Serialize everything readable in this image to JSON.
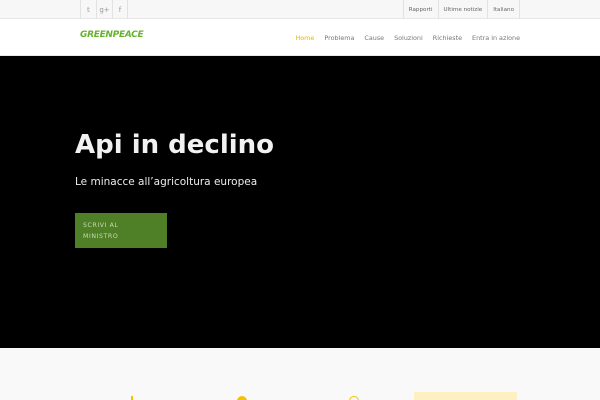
{
  "topbar": {
    "social": [
      {
        "icon": "twitter-icon",
        "glyph": "𝕥"
      },
      {
        "icon": "google-plus-icon",
        "glyph": "g+"
      },
      {
        "icon": "facebook-icon",
        "glyph": "f"
      }
    ],
    "links": [
      "Rapporti",
      "Ultime notizie",
      "Italiano"
    ]
  },
  "header": {
    "logo": "GREENPEACE",
    "nav": [
      "Home",
      "Problema",
      "Cause",
      "Soluzioni",
      "Richieste",
      "Entra in azione"
    ],
    "active_index": 0
  },
  "hero": {
    "title": "Api in declino",
    "subtitle": "Le minacce all’agricoltura europea",
    "cta_line1": "SCRIVI AL",
    "cta_line2": "MINISTRO"
  },
  "colors": {
    "brand_green": "#66b22d",
    "button_green": "#4f7f26",
    "accent_yellow": "#e6b800",
    "hero_bg": "#000000"
  }
}
